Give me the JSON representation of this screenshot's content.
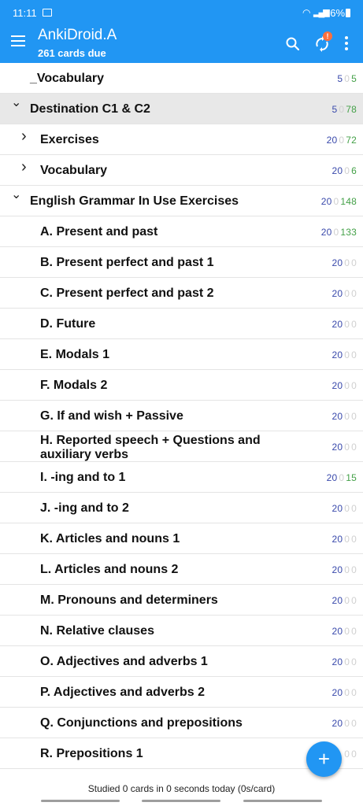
{
  "status": {
    "time": "11:11",
    "battery": "96%"
  },
  "appbar": {
    "title": "AnkiDroid.A",
    "subtitle": "261 cards due"
  },
  "sync_badge": "!",
  "decks": [
    {
      "name": "_Vocabulary",
      "level": 0,
      "chev": "",
      "new": "5",
      "learn": "0",
      "rev": "5"
    },
    {
      "name": "Destination C1 & C2",
      "level": 0,
      "chev": "down",
      "new": "5",
      "learn": "0",
      "rev": "78",
      "highlight": true
    },
    {
      "name": "Exercises",
      "level": 1,
      "chev": "right",
      "new": "20",
      "learn": "0",
      "rev": "72"
    },
    {
      "name": "Vocabulary",
      "level": 1,
      "chev": "right",
      "new": "20",
      "learn": "0",
      "rev": "6"
    },
    {
      "name": "English Grammar In Use Exercises",
      "level": 0,
      "chev": "down",
      "new": "20",
      "learn": "0",
      "rev": "148"
    },
    {
      "name": "A. Present and past",
      "level": 1,
      "chev": "",
      "new": "20",
      "learn": "0",
      "rev": "133"
    },
    {
      "name": "B. Present perfect and past 1",
      "level": 1,
      "chev": "",
      "new": "20",
      "learn": "0",
      "rev": "0"
    },
    {
      "name": "C. Present perfect and past 2",
      "level": 1,
      "chev": "",
      "new": "20",
      "learn": "0",
      "rev": "0"
    },
    {
      "name": "D. Future",
      "level": 1,
      "chev": "",
      "new": "20",
      "learn": "0",
      "rev": "0"
    },
    {
      "name": "E. Modals 1",
      "level": 1,
      "chev": "",
      "new": "20",
      "learn": "0",
      "rev": "0"
    },
    {
      "name": "F. Modals 2",
      "level": 1,
      "chev": "",
      "new": "20",
      "learn": "0",
      "rev": "0"
    },
    {
      "name": "G. If and wish + Passive",
      "level": 1,
      "chev": "",
      "new": "20",
      "learn": "0",
      "rev": "0"
    },
    {
      "name": "H. Reported speech + Questions and auxiliary verbs",
      "level": 1,
      "chev": "",
      "new": "20",
      "learn": "0",
      "rev": "0",
      "wrap": true
    },
    {
      "name": "I. -ing and to 1",
      "level": 1,
      "chev": "",
      "new": "20",
      "learn": "0",
      "rev": "15"
    },
    {
      "name": "J. -ing and to 2",
      "level": 1,
      "chev": "",
      "new": "20",
      "learn": "0",
      "rev": "0"
    },
    {
      "name": "K. Articles and nouns 1",
      "level": 1,
      "chev": "",
      "new": "20",
      "learn": "0",
      "rev": "0"
    },
    {
      "name": "L. Articles and nouns 2",
      "level": 1,
      "chev": "",
      "new": "20",
      "learn": "0",
      "rev": "0"
    },
    {
      "name": "M. Pronouns and determiners",
      "level": 1,
      "chev": "",
      "new": "20",
      "learn": "0",
      "rev": "0"
    },
    {
      "name": "N. Relative clauses",
      "level": 1,
      "chev": "",
      "new": "20",
      "learn": "0",
      "rev": "0"
    },
    {
      "name": "O. Adjectives and adverbs 1",
      "level": 1,
      "chev": "",
      "new": "20",
      "learn": "0",
      "rev": "0"
    },
    {
      "name": "P. Adjectives and adverbs 2",
      "level": 1,
      "chev": "",
      "new": "20",
      "learn": "0",
      "rev": "0"
    },
    {
      "name": "Q. Conjunctions and prepositions",
      "level": 1,
      "chev": "",
      "new": "20",
      "learn": "0",
      "rev": "0"
    },
    {
      "name": "R. Prepositions 1",
      "level": 1,
      "chev": "",
      "new": "",
      "learn": "0",
      "rev": "0"
    }
  ],
  "footer": {
    "text": "Studied 0 cards in 0 seconds today (0s/card)"
  },
  "fab": {
    "label": "+"
  },
  "colors": {
    "primary": "#2196f3",
    "new": "#3949ab",
    "review": "#43a047",
    "zero": "#d0d0d0"
  }
}
